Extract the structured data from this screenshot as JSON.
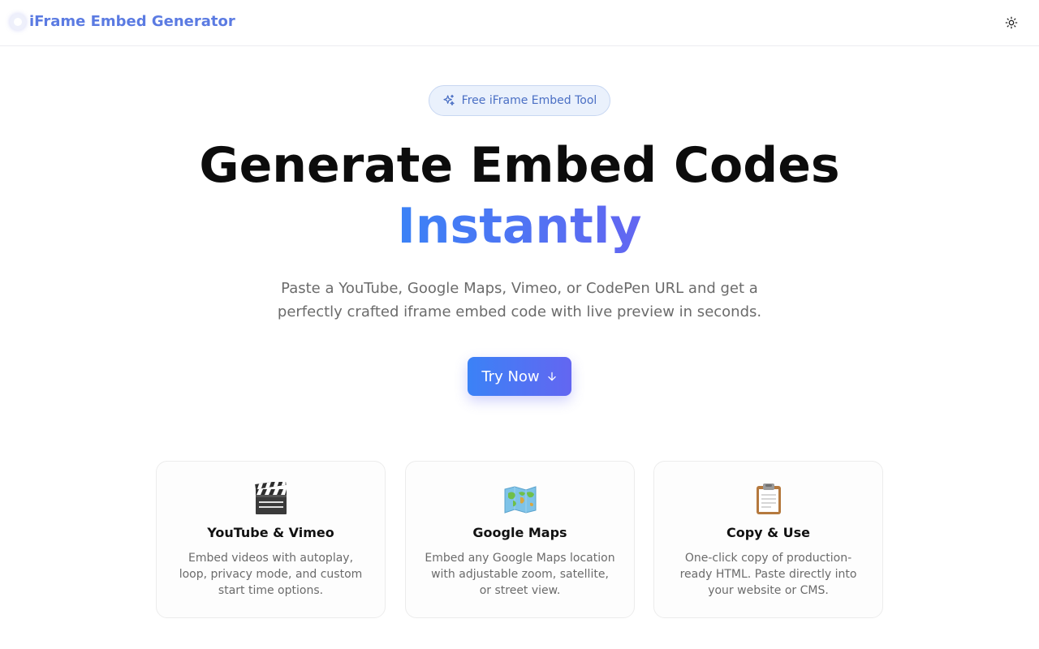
{
  "header": {
    "title": "iFrame Embed Generator",
    "logo_icon": "circle-logo-icon",
    "theme_toggle_icon": "sun-icon"
  },
  "hero": {
    "badge_icon": "sparkles-icon",
    "badge_text": "Free iFrame Embed Tool",
    "headline_line1": "Generate Embed Codes",
    "headline_line2": "Instantly",
    "subtitle": "Paste a YouTube, Google Maps, Vimeo, or CodePen URL and get a perfectly crafted iframe embed code with live preview in seconds.",
    "cta_label": "Try Now",
    "cta_icon": "arrow-down-icon"
  },
  "features": [
    {
      "icon": "clapperboard-icon",
      "title": "YouTube & Vimeo",
      "description": "Embed videos with autoplay, loop, privacy mode, and custom start time options."
    },
    {
      "icon": "world-map-icon",
      "title": "Google Maps",
      "description": "Embed any Google Maps location with adjustable zoom, satellite, or street view."
    },
    {
      "icon": "clipboard-icon",
      "title": "Copy & Use",
      "description": "One-click copy of production-ready HTML. Paste directly into your website or CMS."
    }
  ],
  "colors": {
    "brand": "#5b7be2",
    "gradient_start": "#3b82f6",
    "gradient_end": "#6366f1",
    "badge_bg": "#eaf1fc",
    "muted_text": "#6b6b6b"
  }
}
